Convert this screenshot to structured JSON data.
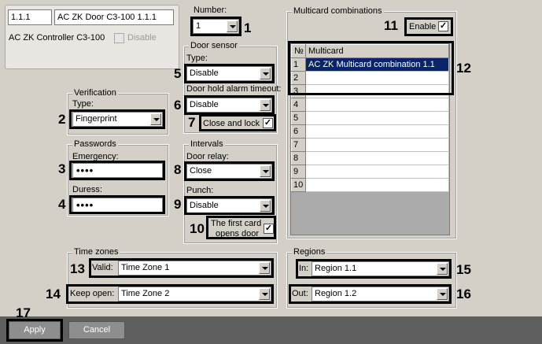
{
  "door_id": "1.1.1",
  "door_name": "AC ZK Door C3-100 1.1.1",
  "controller_name": "AC ZK Controller C3-100",
  "disable_label": "Disable",
  "number": {
    "label": "Number:",
    "value": "1"
  },
  "door_sensor": {
    "title": "Door sensor",
    "type_label": "Type:",
    "type_value": "Disable",
    "alarm_label": "Door hold alarm timeout:",
    "alarm_value": "Disable",
    "close_lock_label": "Close and lock",
    "close_lock_checked": "✓"
  },
  "verification": {
    "title": "Verification",
    "type_label": "Type:",
    "type_value": "Fingerprint"
  },
  "passwords": {
    "title": "Passwords",
    "emergency_label": "Emergency:",
    "emergency_value": "••••",
    "duress_label": "Duress:",
    "duress_value": "••••"
  },
  "intervals": {
    "title": "Intervals",
    "relay_label": "Door relay:",
    "relay_value": "Close",
    "punch_label": "Punch:",
    "punch_value": "Disable",
    "first_card_label_1": "The first card",
    "first_card_label_2": "opens door",
    "first_card_checked": "✓"
  },
  "multicard": {
    "title": "Multicard combinations",
    "enable_label": "Enable",
    "enable_checked": "✓",
    "col_no": "№",
    "col_name": "Multicard",
    "rows": [
      {
        "n": "1",
        "name": "AC ZK Multicard combination 1.1"
      },
      {
        "n": "2",
        "name": ""
      },
      {
        "n": "3",
        "name": ""
      },
      {
        "n": "4",
        "name": ""
      },
      {
        "n": "5",
        "name": ""
      },
      {
        "n": "6",
        "name": ""
      },
      {
        "n": "7",
        "name": ""
      },
      {
        "n": "8",
        "name": ""
      },
      {
        "n": "9",
        "name": ""
      },
      {
        "n": "10",
        "name": ""
      }
    ]
  },
  "time_zones": {
    "title": "Time zones",
    "valid_label": "Valid:",
    "valid_value": "Time Zone 1",
    "keep_label": "Keep open:",
    "keep_value": "Time Zone 2"
  },
  "regions": {
    "title": "Regions",
    "in_label": "In:",
    "in_value": "Region 1.1",
    "out_label": "Out:",
    "out_value": "Region 1.2"
  },
  "buttons": {
    "apply": "Apply",
    "cancel": "Cancel"
  },
  "callouts": [
    "1",
    "2",
    "3",
    "4",
    "5",
    "6",
    "7",
    "8",
    "9",
    "10",
    "11",
    "12",
    "13",
    "14",
    "15",
    "16",
    "17"
  ]
}
